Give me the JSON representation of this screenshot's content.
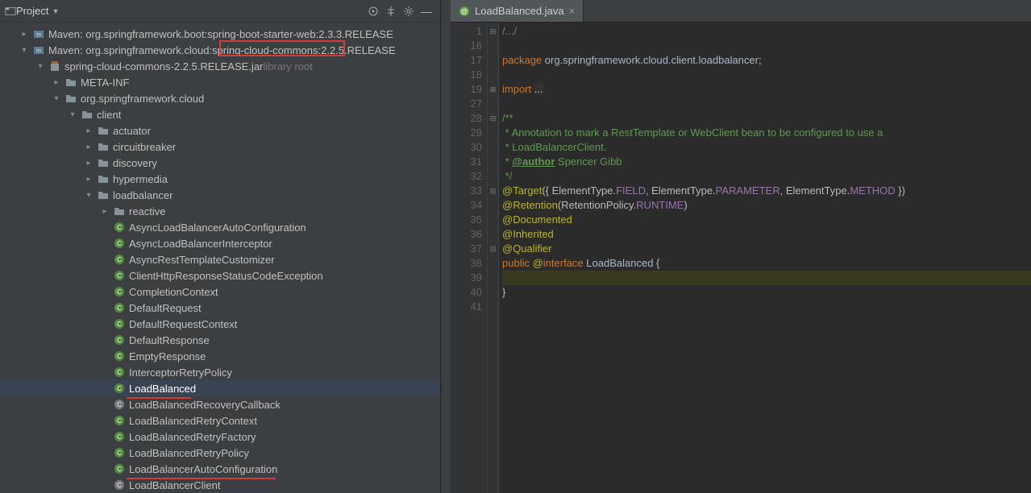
{
  "sidebar": {
    "title": "Project",
    "nodes": [
      {
        "indent": 24,
        "arrow": "right",
        "icon": "maven",
        "text": "Maven: org.springframework.boot:spring-boot-starter-web:2.3.3.RELEASE"
      },
      {
        "indent": 24,
        "arrow": "down",
        "icon": "maven",
        "text": "Maven: org.springframework.cloud:spring-cloud-commons:2.2.5.RELEASE"
      },
      {
        "indent": 44,
        "arrow": "down",
        "icon": "jar",
        "text": "spring-cloud-commons-2.2.5.RELEASE.jar",
        "suffix": " library root"
      },
      {
        "indent": 64,
        "arrow": "right",
        "icon": "folder",
        "text": "META-INF"
      },
      {
        "indent": 64,
        "arrow": "down",
        "icon": "folder",
        "text": "org.springframework.cloud"
      },
      {
        "indent": 84,
        "arrow": "down",
        "icon": "folder",
        "text": "client"
      },
      {
        "indent": 104,
        "arrow": "right",
        "icon": "folder",
        "text": "actuator"
      },
      {
        "indent": 104,
        "arrow": "right",
        "icon": "folder",
        "text": "circuitbreaker"
      },
      {
        "indent": 104,
        "arrow": "right",
        "icon": "folder",
        "text": "discovery"
      },
      {
        "indent": 104,
        "arrow": "right",
        "icon": "folder",
        "text": "hypermedia"
      },
      {
        "indent": 104,
        "arrow": "down",
        "icon": "folder",
        "text": "loadbalancer"
      },
      {
        "indent": 124,
        "arrow": "right",
        "icon": "folder",
        "text": "reactive"
      },
      {
        "indent": 124,
        "arrow": "",
        "icon": "class",
        "text": "AsyncLoadBalancerAutoConfiguration"
      },
      {
        "indent": 124,
        "arrow": "",
        "icon": "class",
        "text": "AsyncLoadBalancerInterceptor"
      },
      {
        "indent": 124,
        "arrow": "",
        "icon": "class",
        "text": "AsyncRestTemplateCustomizer"
      },
      {
        "indent": 124,
        "arrow": "",
        "icon": "class",
        "text": "ClientHttpResponseStatusCodeException"
      },
      {
        "indent": 124,
        "arrow": "",
        "icon": "class",
        "text": "CompletionContext"
      },
      {
        "indent": 124,
        "arrow": "",
        "icon": "class",
        "text": "DefaultRequest"
      },
      {
        "indent": 124,
        "arrow": "",
        "icon": "class",
        "text": "DefaultRequestContext"
      },
      {
        "indent": 124,
        "arrow": "",
        "icon": "class",
        "text": "DefaultResponse"
      },
      {
        "indent": 124,
        "arrow": "",
        "icon": "class",
        "text": "EmptyResponse"
      },
      {
        "indent": 124,
        "arrow": "",
        "icon": "class",
        "text": "InterceptorRetryPolicy"
      },
      {
        "indent": 124,
        "arrow": "",
        "icon": "class",
        "text": "LoadBalanced",
        "sel": true
      },
      {
        "indent": 124,
        "arrow": "",
        "icon": "class-grey",
        "text": "LoadBalancedRecoveryCallback"
      },
      {
        "indent": 124,
        "arrow": "",
        "icon": "class",
        "text": "LoadBalancedRetryContext"
      },
      {
        "indent": 124,
        "arrow": "",
        "icon": "class",
        "text": "LoadBalancedRetryFactory"
      },
      {
        "indent": 124,
        "arrow": "",
        "icon": "class",
        "text": "LoadBalancedRetryPolicy"
      },
      {
        "indent": 124,
        "arrow": "",
        "icon": "class",
        "text": "LoadBalancerAutoConfiguration"
      },
      {
        "indent": 124,
        "arrow": "",
        "icon": "class-grey",
        "text": "LoadBalancerClient"
      }
    ]
  },
  "editor": {
    "tab_name": "LoadBalanced.java",
    "lines": [
      {
        "n": 1,
        "fold": "⊟",
        "html": "<span class='com'>/.../</span>"
      },
      {
        "n": 16,
        "html": ""
      },
      {
        "n": 17,
        "html": "<span class='kw'>package</span> <span class='pkg'>org.springframework.cloud.client.loadbalancer</span>;"
      },
      {
        "n": 18,
        "html": ""
      },
      {
        "n": 19,
        "fold": "⊞",
        "html": "<span class='kw'>import</span> <span class='hl'>...</span>"
      },
      {
        "n": 27,
        "html": ""
      },
      {
        "n": 28,
        "fold": "⊟",
        "html": "<span class='doc'>/**</span>"
      },
      {
        "n": 29,
        "html": "<span class='doc'> * Annotation to mark a RestTemplate or WebClient bean to be configured to use a</span>"
      },
      {
        "n": 30,
        "html": "<span class='doc'> * LoadBalancerClient.</span>"
      },
      {
        "n": 31,
        "html": "<span class='doc'> * </span><span class='doctag'>@author</span><span class='doc'> Spencer Gibb</span>"
      },
      {
        "n": 32,
        "html": "<span class='doc'> */</span>"
      },
      {
        "n": 33,
        "fold": "⊟",
        "html": "<span class='ann'>@Target</span>({ ElementType.<span class='id'>FIELD</span>, ElementType.<span class='id'>PARAMETER</span>, ElementType.<span class='id'>METHOD</span> })"
      },
      {
        "n": 34,
        "html": "<span class='ann'>@Retention</span>(RetentionPolicy.<span class='id'>RUNTIME</span>)"
      },
      {
        "n": 35,
        "html": "<span class='ann'>@Documented</span>"
      },
      {
        "n": 36,
        "html": "<span class='ann'>@Inherited</span>"
      },
      {
        "n": 37,
        "fold": "⊟",
        "html": "<span class='ann'>@Qualifier</span>"
      },
      {
        "n": 38,
        "html": "<span class='kw'>public</span> <span class='ann'>@</span><span class='kw'>interface</span> <span class='cls'>LoadBalanced</span> {"
      },
      {
        "n": 39,
        "cur": true,
        "html": ""
      },
      {
        "n": 40,
        "html": "}"
      },
      {
        "n": 41,
        "html": ""
      }
    ]
  }
}
